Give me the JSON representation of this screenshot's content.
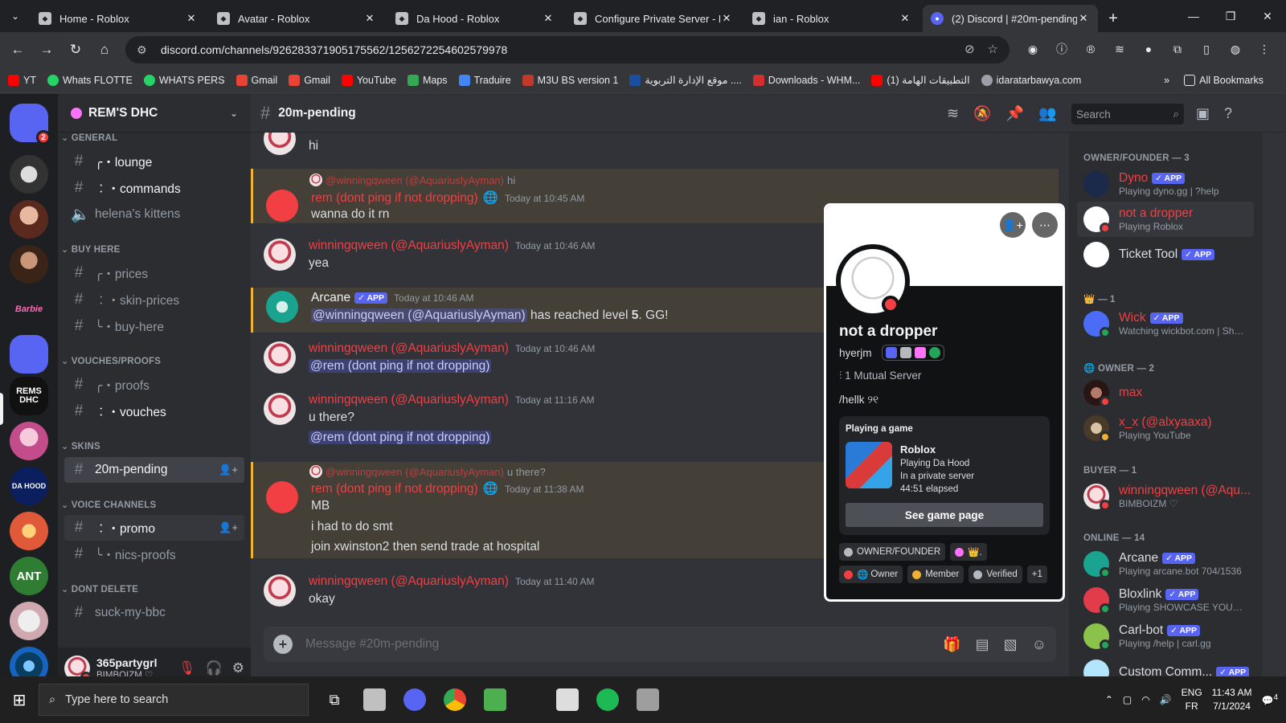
{
  "browser": {
    "tabs": [
      "Home - Roblox",
      "Avatar - Roblox",
      "Da Hood - Roblox",
      "Configure Private Server - Ro",
      "ian - Roblox",
      "(2) Discord | #20m-pending"
    ],
    "url": "discord.com/channels/926283371905175562/1256272254602579978",
    "bookmarks": [
      "YT",
      "Whats FLOTTE",
      "WHATS PERS",
      "Gmail",
      "Gmail",
      "YouTube",
      "Maps",
      "Traduire",
      "M3U BS version 1",
      "موقع الإدارة التربوية ....",
      "Downloads - WHM...",
      "التطبيقات الهامة (1)",
      "idaratarbawya.com"
    ],
    "all_bookmarks": "All Bookmarks"
  },
  "server": {
    "name": "REM'S DHC",
    "badge": "2"
  },
  "categories": {
    "general": "GENERAL",
    "buy": "BUY HERE",
    "vouches": "VOUCHES/PROOFS",
    "skins": "SKINS",
    "voice": "VOICE CHANNELS",
    "dont": "DONT DELETE"
  },
  "channels": {
    "lounge": "╭・lounge",
    "commands": "︰・commands",
    "kittens": "helena's kittens",
    "prices": "╭・prices",
    "skin": "︰・skin-prices",
    "buy": "╰・buy-here",
    "proofs": "╭・proofs",
    "vouches": "︰・vouches",
    "pending": "20m-pending",
    "promo": "︰・promo",
    "nics": "╰・nics-proofs",
    "bbc": "suck-my-bbc"
  },
  "user": {
    "name": "365partygrl",
    "sub": "BIMBOIZM ♡"
  },
  "channel_header": {
    "name": "20m-pending",
    "search": "Search"
  },
  "messages": {
    "m0": "hi",
    "m1_reply_name": "@winningqween (@AquariuslyAyman)",
    "m1_reply": "hi",
    "m1_author": "rem (dont ping if not dropping)",
    "m1_ts": "Today at 10:45 AM",
    "m1_body": "wanna do it rn",
    "m2_author": "winningqween (@AquariuslyAyman)",
    "m2_ts": "Today at 10:46 AM",
    "m2_body": "yea",
    "m3_author": "Arcane",
    "m3_tag": "✓ APP",
    "m3_ts": "Today at 10:46 AM",
    "m3_mention": "@winningqween (@AquariuslyAyman)",
    "m3_text": " has reached level ",
    "m3_level": "5",
    "m3_end": ". GG!",
    "m4_author": "winningqween (@AquariuslyAyman)",
    "m4_ts": "Today at 10:46 AM",
    "m4_mention": "@rem (dont ping if not dropping)",
    "m5_author": "winningqween (@AquariuslyAyman)",
    "m5_ts": "Today at 11:16 AM",
    "m5_body": "u there?",
    "m5_mention": "@rem (dont ping if not dropping)",
    "m6_reply_name": "@winningqween (@AquariuslyAyman)",
    "m6_reply": "u there?",
    "m6_author": "rem (dont ping if not dropping)",
    "m6_ts": "Today at 11:38 AM",
    "m6_body": "MB",
    "m6_b2": "i had to do smt",
    "m6_b3": "join xwinston2 then send trade at hospital",
    "m7_author": "winningqween (@AquariuslyAyman)",
    "m7_ts": "Today at 11:40 AM",
    "m7_body": "okay"
  },
  "composer": {
    "placeholder": "Message #20m-pending"
  },
  "members": {
    "s1": "OWNER/FOUNDER — 3",
    "dyno": "Dyno",
    "dyno_s": "Playing dyno.gg | ?help",
    "nad": "not a dropper",
    "nad_s": "Playing Roblox",
    "ticket": "Ticket Tool",
    "s2": "— 1",
    "wick": "Wick",
    "wick_s": "Watching wickbot.com | Shar...",
    "s3": "OWNER — 2",
    "max": "max",
    "xx": "x_x (@alxyaaxa)",
    "xx_s": "Playing YouTube",
    "s4": "BUYER — 1",
    "wq": "winningqween (@Aqu...",
    "wq_s": "BIMBOIZM ♡",
    "s5": "ONLINE — 14",
    "arc": "Arcane",
    "arc_s": "Playing arcane.bot 704/1536",
    "blox": "Bloxlink",
    "blox_s": "Playing SHOWCASE YOUR SE...",
    "carl": "Carl-bot",
    "carl_s": "Playing /help | carl.gg",
    "custom": "Custom Comm...",
    "app": "✓ APP"
  },
  "popout": {
    "name": "not a dropper",
    "handle": "hyerjm",
    "mutual": "1 Mutual Server",
    "bio": "/hellk ୨୧",
    "activity_title": "Playing a game",
    "game": "Roblox",
    "detail1": "Playing Da Hood",
    "detail2": "In a private server",
    "elapsed": "44:51 elapsed",
    "button": "See game page",
    "roles": [
      "OWNER/FOUNDER",
      "Owner",
      "Member",
      "Verified",
      "+1"
    ]
  },
  "taskbar": {
    "search": "Type here to search",
    "lang1": "ENG",
    "lang2": "FR",
    "time": "11:43 AM",
    "date": "7/1/2024",
    "notif": "4"
  }
}
